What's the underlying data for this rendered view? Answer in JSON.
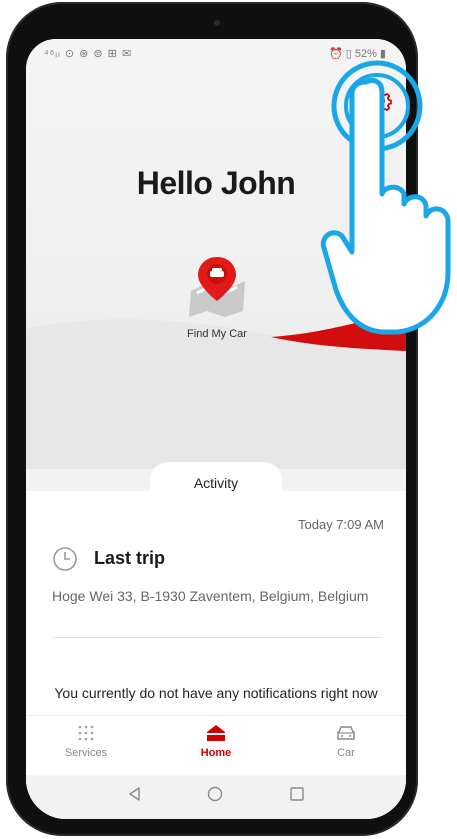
{
  "status": {
    "left_icons": "⁴⁶ᵢₗ ⊙ ⊛ ⊜ ⊞ ✉",
    "right": "⏰ ▯ 52% ▮"
  },
  "header": {
    "greeting": "Hello John"
  },
  "find_car": {
    "label": "Find My Car"
  },
  "activity": {
    "tab_label": "Activity",
    "timestamp": "Today 7:09 AM",
    "trip_title": "Last trip",
    "trip_address": "Hoge Wei 33, B-1930 Zaventem, Belgium, Belgium",
    "notifications_empty": "You currently do not have any notifications right now"
  },
  "tabs": [
    {
      "label": "Services",
      "icon": "grid-dots-icon",
      "active": false
    },
    {
      "label": "Home",
      "icon": "home-icon",
      "active": true
    },
    {
      "label": "Car",
      "icon": "car-icon",
      "active": false
    }
  ],
  "colors": {
    "accent": "#d10000",
    "highlight": "#1aa7e8"
  }
}
